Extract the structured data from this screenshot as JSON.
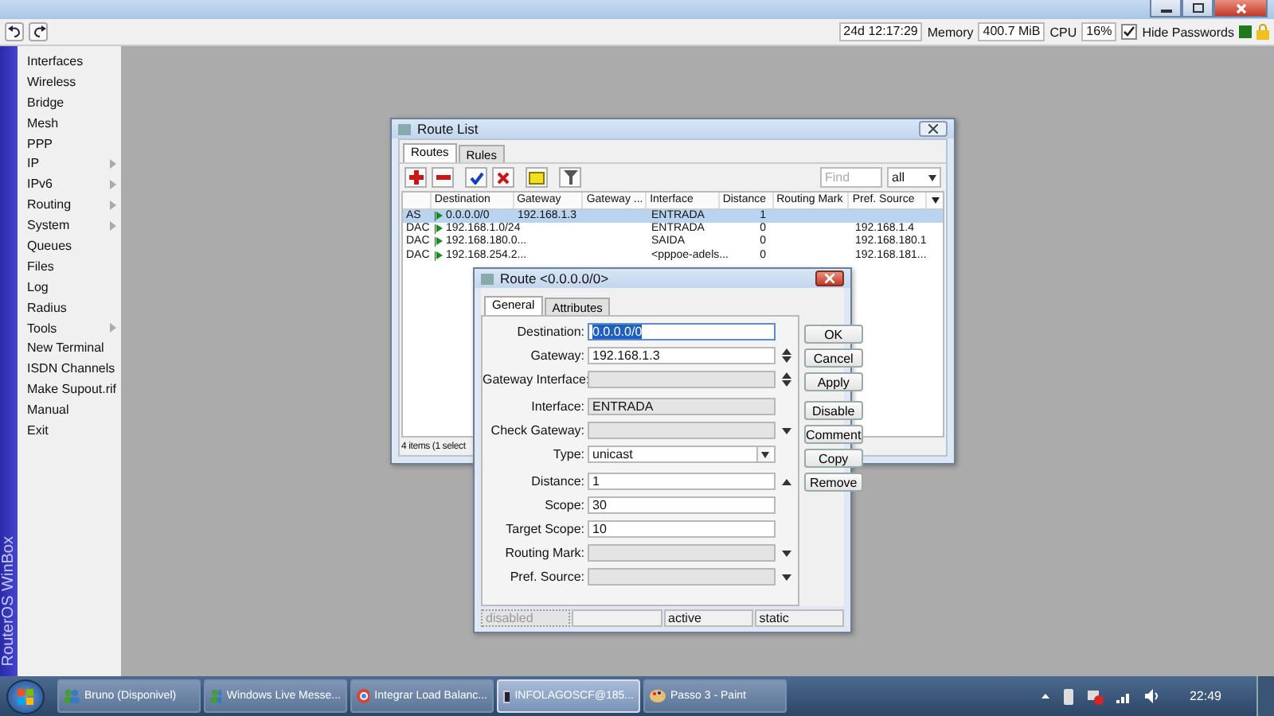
{
  "toolbar": {
    "uptime": "24d 12:17:29",
    "memory_label": "Memory",
    "memory": "400.7 MiB",
    "cpu_label": "CPU",
    "cpu": "16%",
    "hide_passwords": {
      "label": "Hide Passwords",
      "checked": true
    }
  },
  "sidebar": {
    "brand": "RouterOS WinBox",
    "items": [
      {
        "label": "Interfaces",
        "submenu": false
      },
      {
        "label": "Wireless",
        "submenu": false
      },
      {
        "label": "Bridge",
        "submenu": false
      },
      {
        "label": "Mesh",
        "submenu": false
      },
      {
        "label": "PPP",
        "submenu": false
      },
      {
        "label": "IP",
        "submenu": true
      },
      {
        "label": "IPv6",
        "submenu": true
      },
      {
        "label": "Routing",
        "submenu": true
      },
      {
        "label": "System",
        "submenu": true
      },
      {
        "label": "Queues",
        "submenu": false
      },
      {
        "label": "Files",
        "submenu": false
      },
      {
        "label": "Log",
        "submenu": false
      },
      {
        "label": "Radius",
        "submenu": false
      },
      {
        "label": "Tools",
        "submenu": true
      },
      {
        "label": "New Terminal",
        "submenu": false
      },
      {
        "label": "ISDN Channels",
        "submenu": false
      },
      {
        "label": "Make Supout.rif",
        "submenu": false
      },
      {
        "label": "Manual",
        "submenu": false
      },
      {
        "label": "Exit",
        "submenu": false
      }
    ]
  },
  "route_list": {
    "title": "Route List",
    "tabs": [
      {
        "label": "Routes",
        "selected": true
      },
      {
        "label": "Rules",
        "selected": false
      }
    ],
    "find": {
      "placeholder": "Find"
    },
    "filter": "all",
    "columns": [
      "Destination",
      "Gateway",
      "Gateway ...",
      "Interface",
      "Distance",
      "Routing Mark",
      "Pref. Source"
    ],
    "rows": [
      {
        "flags": "AS",
        "destination": "0.0.0.0/0",
        "gateway": "192.168.1.3",
        "interface": "ENTRADA",
        "distance": "1",
        "selected": true
      },
      {
        "flags": "DAC",
        "destination": "192.168.1.0/24",
        "interface": "ENTRADA",
        "distance": "0",
        "pref_source": "192.168.1.4",
        "selected": false
      },
      {
        "flags": "DAC",
        "destination": "192.168.180.0...",
        "interface": "SAIDA",
        "distance": "0",
        "pref_source": "192.168.180.1",
        "selected": false
      },
      {
        "flags": "DAC",
        "destination": "192.168.254.2...",
        "interface": "<pppoe-adels...",
        "distance": "0",
        "pref_source": "192.168.181...",
        "selected": false
      }
    ],
    "status": "4 items (1 select"
  },
  "route_dialog": {
    "title": "Route <0.0.0.0/0>",
    "tabs": [
      {
        "label": "General",
        "selected": true
      },
      {
        "label": "Attributes",
        "selected": false
      }
    ],
    "sections": [
      {
        "fields": [
          {
            "label": "Destination:",
            "value": "0.0.0.0/0",
            "kind": "plain",
            "disabled": false,
            "text_selected": true
          },
          {
            "label": "Gateway:",
            "value": "192.168.1.3",
            "kind": "spin",
            "disabled": false,
            "text_selected": false
          },
          {
            "label": "Gateway Interface:",
            "kind": "spin",
            "disabled": true,
            "text_selected": false
          }
        ]
      },
      {
        "fields": [
          {
            "label": "Interface:",
            "value": "ENTRADA",
            "kind": "plain",
            "disabled": true,
            "text_selected": false
          },
          {
            "label": "Check Gateway:",
            "kind": "combo",
            "disabled": true,
            "text_selected": false
          },
          {
            "label": "Type:",
            "value": "unicast",
            "kind": "select",
            "disabled": false,
            "text_selected": false
          }
        ]
      },
      {
        "fields": [
          {
            "label": "Distance:",
            "value": "1",
            "kind": "up",
            "disabled": false,
            "text_selected": false
          },
          {
            "label": "Scope:",
            "value": "30",
            "kind": "plain",
            "disabled": false,
            "text_selected": false
          },
          {
            "label": "Target Scope:",
            "value": "10",
            "kind": "plain",
            "disabled": false,
            "text_selected": false
          },
          {
            "label": "Routing Mark:",
            "kind": "combo",
            "disabled": true,
            "text_selected": false
          },
          {
            "label": "Pref. Source:",
            "kind": "combo",
            "disabled": true,
            "text_selected": false
          }
        ]
      }
    ],
    "button_groups": [
      [
        "OK",
        "Cancel",
        "Apply"
      ],
      [
        "Disable",
        "Comment",
        "Copy",
        "Remove"
      ]
    ],
    "status": [
      {
        "text": "disabled",
        "disabled": true
      },
      {
        "disabled": false
      },
      {
        "text": "active",
        "disabled": false
      },
      {
        "text": "static",
        "disabled": false
      }
    ]
  },
  "taskbar": {
    "items": [
      {
        "label": "Bruno (Disponivel)",
        "kind": "people",
        "selected": false
      },
      {
        "label": "Windows Live Messe...",
        "kind": "people",
        "selected": false
      },
      {
        "label": "Integrar Load Balanc...",
        "kind": "browser",
        "selected": false
      },
      {
        "label": "INFOLAGOSCF@185...",
        "kind": "terminal",
        "selected": true
      },
      {
        "label": "Passo 3 - Paint",
        "kind": "paint",
        "selected": false
      }
    ],
    "clock": "22:49"
  }
}
